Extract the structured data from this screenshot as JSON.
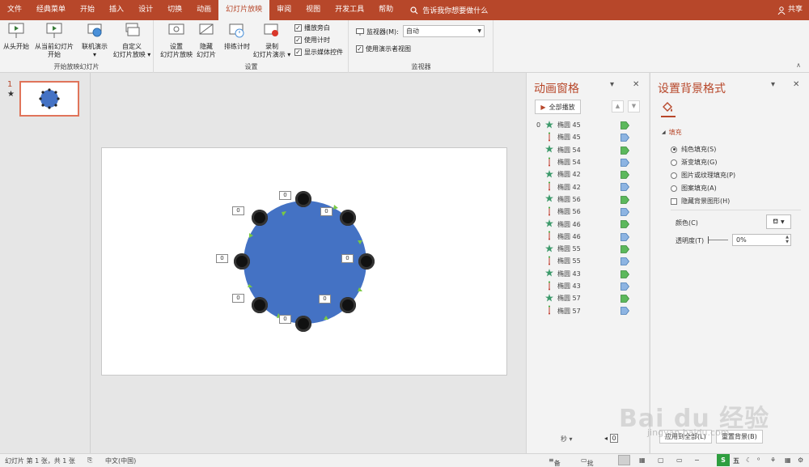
{
  "menubar": {
    "tabs": [
      "文件",
      "经典菜单",
      "开始",
      "插入",
      "设计",
      "切换",
      "动画",
      "幻灯片放映",
      "审阅",
      "视图",
      "开发工具",
      "帮助"
    ],
    "active_tab": "幻灯片放映",
    "tell_me": "告诉我你想要做什么",
    "share": "共享"
  },
  "ribbon": {
    "group_start": {
      "label": "开始放映幻灯片",
      "btn_from_start": "从头开始",
      "btn_from_current_1": "从当前幻灯片",
      "btn_from_current_2": "开始",
      "btn_online_1": "联机演示",
      "btn_online_2": "▾",
      "btn_custom_1": "自定义",
      "btn_custom_2": "幻灯片放映 ▾"
    },
    "group_setup": {
      "label": "设置",
      "btn_setup_1": "设置",
      "btn_setup_2": "幻灯片放映",
      "btn_hide_1": "隐藏",
      "btn_hide_2": "幻灯片",
      "btn_rehearse": "排练计时",
      "btn_record_1": "录制",
      "btn_record_2": "幻灯片演示 ▾",
      "chk_narration": "播放旁白",
      "chk_timings": "使用计时",
      "chk_media": "显示媒体控件"
    },
    "group_monitors": {
      "label": "监视器",
      "monitor_label": "监视器(M):",
      "monitor_value": "自动",
      "presenter_view": "使用演示者视图"
    }
  },
  "thumbnails": {
    "number": "1",
    "star": "★"
  },
  "slide": {
    "timing_tags": [
      "0",
      "0",
      "0",
      "0",
      "0",
      "0",
      "0",
      "0"
    ]
  },
  "animation_pane": {
    "title": "动画窗格",
    "play_all": "全部播放",
    "items": [
      {
        "idx": "0",
        "type": "star",
        "name": "椭圆 45",
        "bar": "green"
      },
      {
        "idx": "",
        "type": "line",
        "name": "椭圆 45",
        "bar": "blue"
      },
      {
        "idx": "",
        "type": "star",
        "name": "椭圆 54",
        "bar": "green"
      },
      {
        "idx": "",
        "type": "line",
        "name": "椭圆 54",
        "bar": "blue"
      },
      {
        "idx": "",
        "type": "star",
        "name": "椭圆 42",
        "bar": "green"
      },
      {
        "idx": "",
        "type": "line",
        "name": "椭圆 42",
        "bar": "blue"
      },
      {
        "idx": "",
        "type": "star",
        "name": "椭圆 56",
        "bar": "green"
      },
      {
        "idx": "",
        "type": "line",
        "name": "椭圆 56",
        "bar": "blue"
      },
      {
        "idx": "",
        "type": "star",
        "name": "椭圆 46",
        "bar": "green"
      },
      {
        "idx": "",
        "type": "line",
        "name": "椭圆 46",
        "bar": "blue"
      },
      {
        "idx": "",
        "type": "star",
        "name": "椭圆 55",
        "bar": "green"
      },
      {
        "idx": "",
        "type": "line",
        "name": "椭圆 55",
        "bar": "blue"
      },
      {
        "idx": "",
        "type": "star",
        "name": "椭圆 43",
        "bar": "green"
      },
      {
        "idx": "",
        "type": "line",
        "name": "椭圆 43",
        "bar": "blue"
      },
      {
        "idx": "",
        "type": "star",
        "name": "椭圆 57",
        "bar": "green"
      },
      {
        "idx": "",
        "type": "line",
        "name": "椭圆 57",
        "bar": "blue"
      }
    ],
    "seconds_label": "秒 ▾",
    "zoom_value": "0"
  },
  "format_pane": {
    "title": "设置背景格式",
    "section": "填充",
    "options": [
      {
        "label": "纯色填充(S)",
        "checked": true
      },
      {
        "label": "渐变填充(G)",
        "checked": false
      },
      {
        "label": "图片或纹理填充(P)",
        "checked": false
      },
      {
        "label": "图案填充(A)",
        "checked": false
      }
    ],
    "hide_bg": "隐藏背景图形(H)",
    "color_label": "颜色(C)",
    "transparency_label": "透明度(T)",
    "transparency_value": "0%",
    "apply_all": "应用到全部(L)",
    "reset_bg": "重置背景(B)"
  },
  "statusbar": {
    "slide_info": "幻灯片 第 1 张，共 1 张",
    "language": "中文(中国)",
    "notes": "备注",
    "comments": "批注"
  },
  "watermark": {
    "text": "Bai du 经验",
    "sub": "jingyan.baidu.com"
  },
  "colors": {
    "accent": "#b7472a",
    "circle": "#4472c4",
    "bar_green": "#5cb85c",
    "bar_blue": "#8db4e2"
  }
}
